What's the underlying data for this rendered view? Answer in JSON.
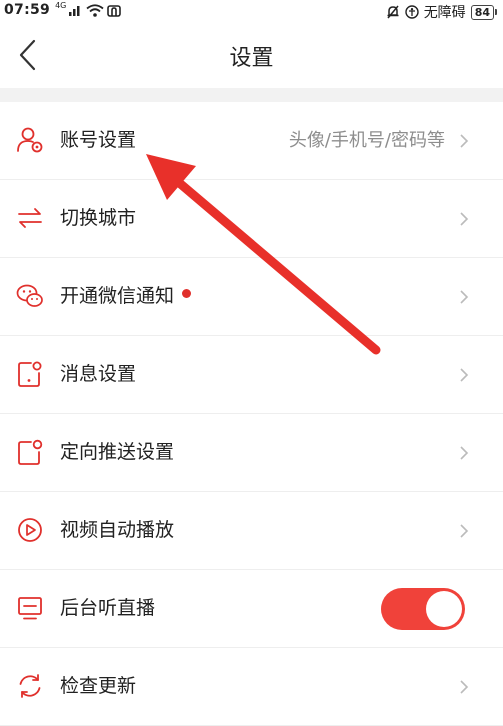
{
  "status_bar": {
    "time": "07:59",
    "network": "4G",
    "accessibility": "无障碍",
    "battery": "84"
  },
  "header": {
    "title": "设置"
  },
  "settings": [
    {
      "label": "账号设置",
      "value": "头像/手机号/密码等",
      "icon": "user-gear-icon"
    },
    {
      "label": "切换城市",
      "icon": "switch-arrows-icon"
    },
    {
      "label": "开通微信通知",
      "icon": "wechat-icon",
      "badge": "red-dot"
    },
    {
      "label": "消息设置",
      "icon": "message-device-icon"
    },
    {
      "label": "定向推送设置",
      "icon": "push-notification-icon"
    },
    {
      "label": "视频自动播放",
      "icon": "play-circle-icon"
    },
    {
      "label": "后台听直播",
      "icon": "monitor-icon",
      "toggle": true
    },
    {
      "label": "检查更新",
      "icon": "refresh-icon"
    }
  ],
  "colors": {
    "accent": "#e0302c",
    "toggle_on": "#f0423a",
    "annotation_arrow": "#e8302a"
  }
}
